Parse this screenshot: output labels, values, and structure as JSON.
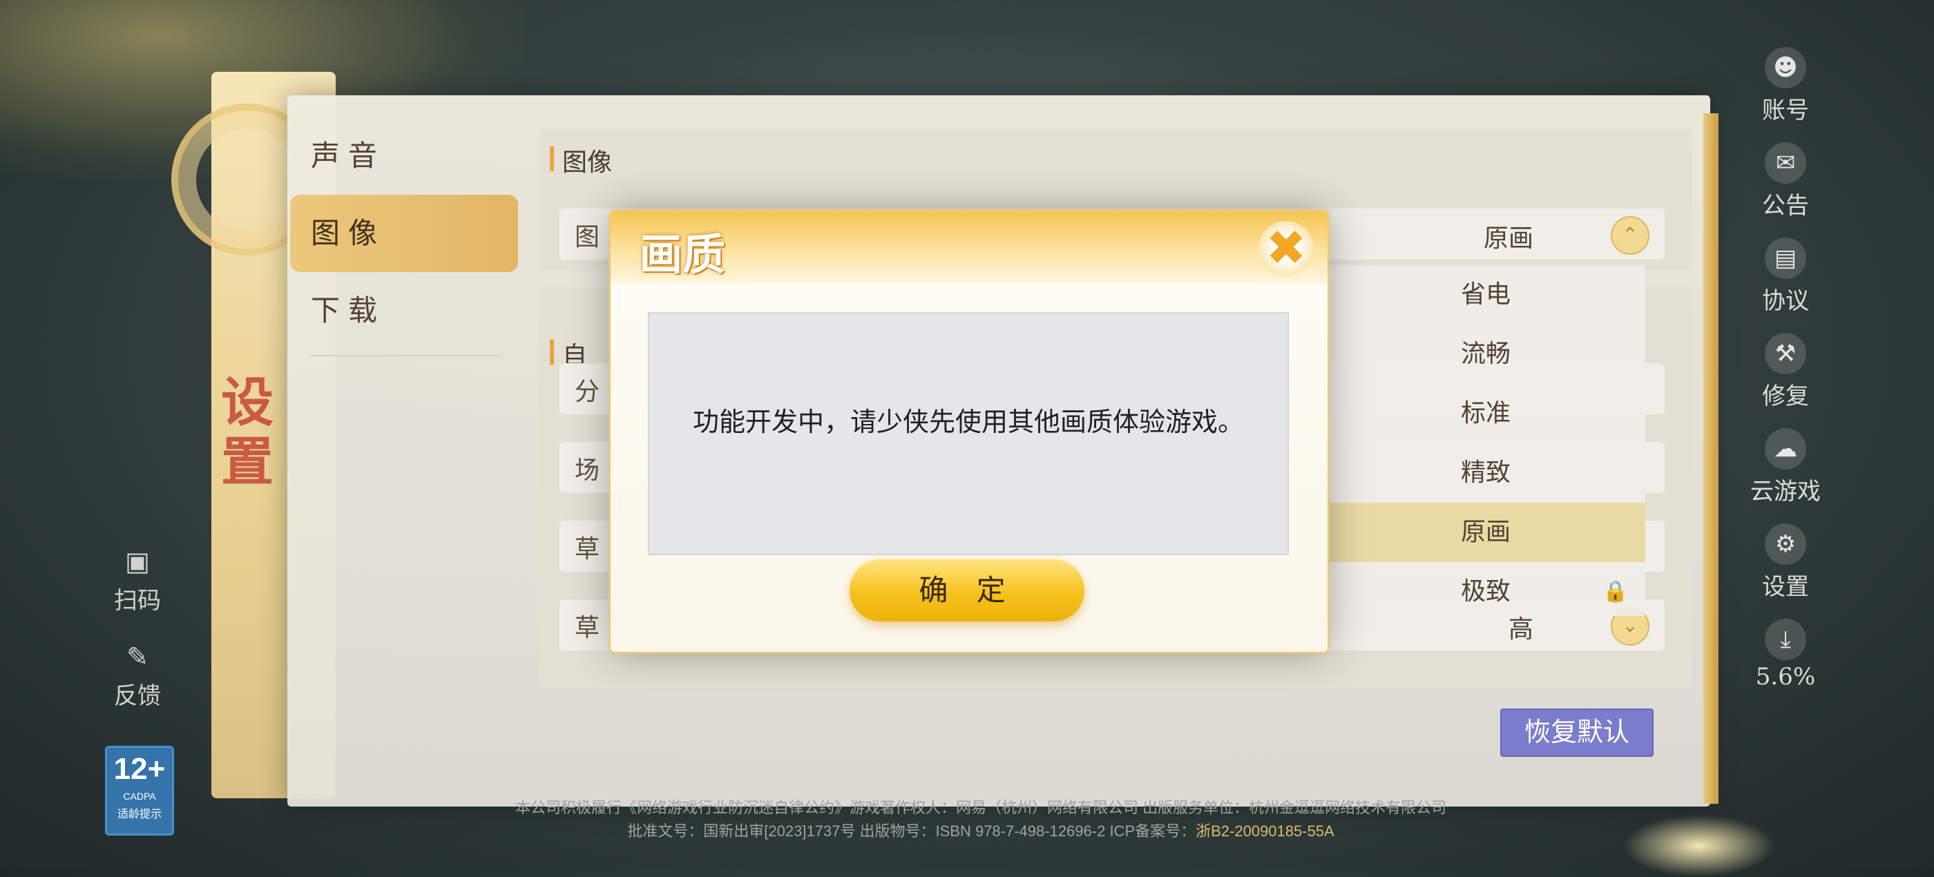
{
  "right_menu": [
    {
      "icon": "account-icon",
      "label": "账号"
    },
    {
      "icon": "notice-icon",
      "label": "公告"
    },
    {
      "icon": "agreement-icon",
      "label": "协议"
    },
    {
      "icon": "repair-icon",
      "label": "修复"
    },
    {
      "icon": "cloud-game-icon",
      "label": "云游戏"
    },
    {
      "icon": "settings-gear-icon",
      "label": "设置"
    },
    {
      "icon": "download-icon",
      "label": "5.6%"
    }
  ],
  "left_tools": {
    "scan": "扫码",
    "feedback": "反馈",
    "age_rating": {
      "number": "12+",
      "org": "CADPA",
      "note": "适龄提示"
    }
  },
  "settings": {
    "vertical_title": "设置",
    "nav": [
      "声音",
      "图像",
      "下载"
    ],
    "active_nav": 1,
    "section1_title": "图像",
    "section2_title": "自",
    "rows": [
      {
        "label": "图",
        "value": "原画"
      },
      {
        "label": "分",
        "value": ""
      },
      {
        "label": "场",
        "value": ""
      },
      {
        "label": "草",
        "value": ""
      },
      {
        "label": "草",
        "value": "高"
      }
    ],
    "dropdown_options": [
      "省电",
      "流畅",
      "标准",
      "精致",
      "原画",
      "极致"
    ],
    "dropdown_selected": 4,
    "restore_button": "恢复默认"
  },
  "footer": {
    "line1": "本公司积极履行《网络游戏行业防沉迷自律公约》游戏著作权人：网易（杭州）网络有限公司 出版服务单位：杭州金逗逗网络技术有限公司",
    "line2_prefix": "批准文号：国新出审[2023]1737号  出版物号：ISBN 978-7-498-12696-2  ICP备案号：",
    "line2_icp": "浙B2-20090185-55A"
  },
  "modal": {
    "title": "画质",
    "message": "功能开发中，请少侠先使用其他画质体验游戏。",
    "ok_button": "确 定"
  },
  "colors": {
    "accent_gold": "#f5c11c",
    "restore_button": "#7478c9",
    "title_red": "#c8553b"
  }
}
